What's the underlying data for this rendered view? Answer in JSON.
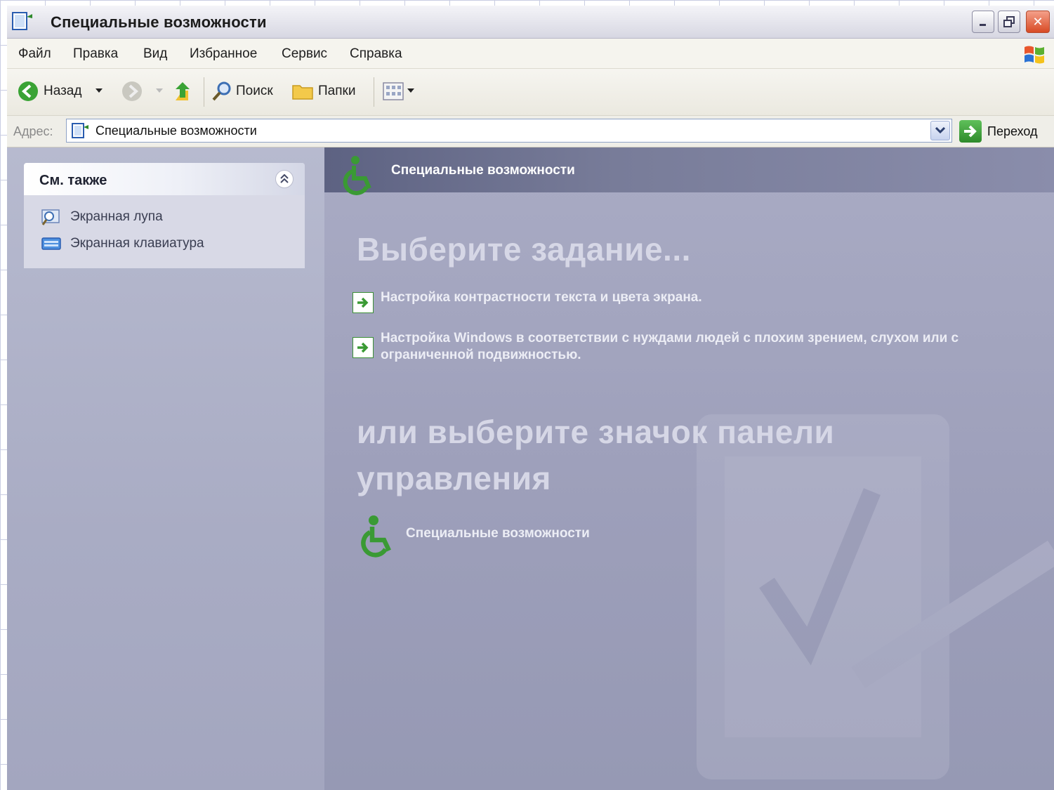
{
  "window": {
    "title": "Специальные возможности",
    "icon": "accessibility-folder-icon"
  },
  "title_buttons": {
    "minimize_icon": "minimize-icon",
    "maximize_icon": "restore-icon",
    "close_label": "✕"
  },
  "menu": {
    "items": [
      "Файл",
      "Правка",
      "Вид",
      "Избранное",
      "Сервис",
      "Справка"
    ]
  },
  "toolbar": {
    "back_label": "Назад",
    "search_label": "Поиск",
    "folders_label": "Папки"
  },
  "address": {
    "label": "Адрес:",
    "value": "Специальные возможности",
    "go_label": "Переход"
  },
  "sidebar": {
    "see_also_title": "См. также",
    "items": [
      {
        "label": "Экранная лупа",
        "icon": "magnifier-icon"
      },
      {
        "label": "Экранная клавиатура",
        "icon": "keyboard-icon"
      }
    ]
  },
  "main": {
    "header_title": "Специальные возможности",
    "task_heading": "Выберите задание...",
    "tasks": [
      "Настройка контрастности текста и цвета экрана.",
      "Настройка Windows в соответствии с нуждами людей с плохим зрением, слухом или с ограниченной подвижностью."
    ],
    "or_heading": "или выберите значок панели управления",
    "control_panel_item": "Специальные возможности"
  },
  "colors": {
    "accent_green": "#3a9a34",
    "pane_blue": "#a9abc4",
    "header_band": "#6a6e8c"
  }
}
